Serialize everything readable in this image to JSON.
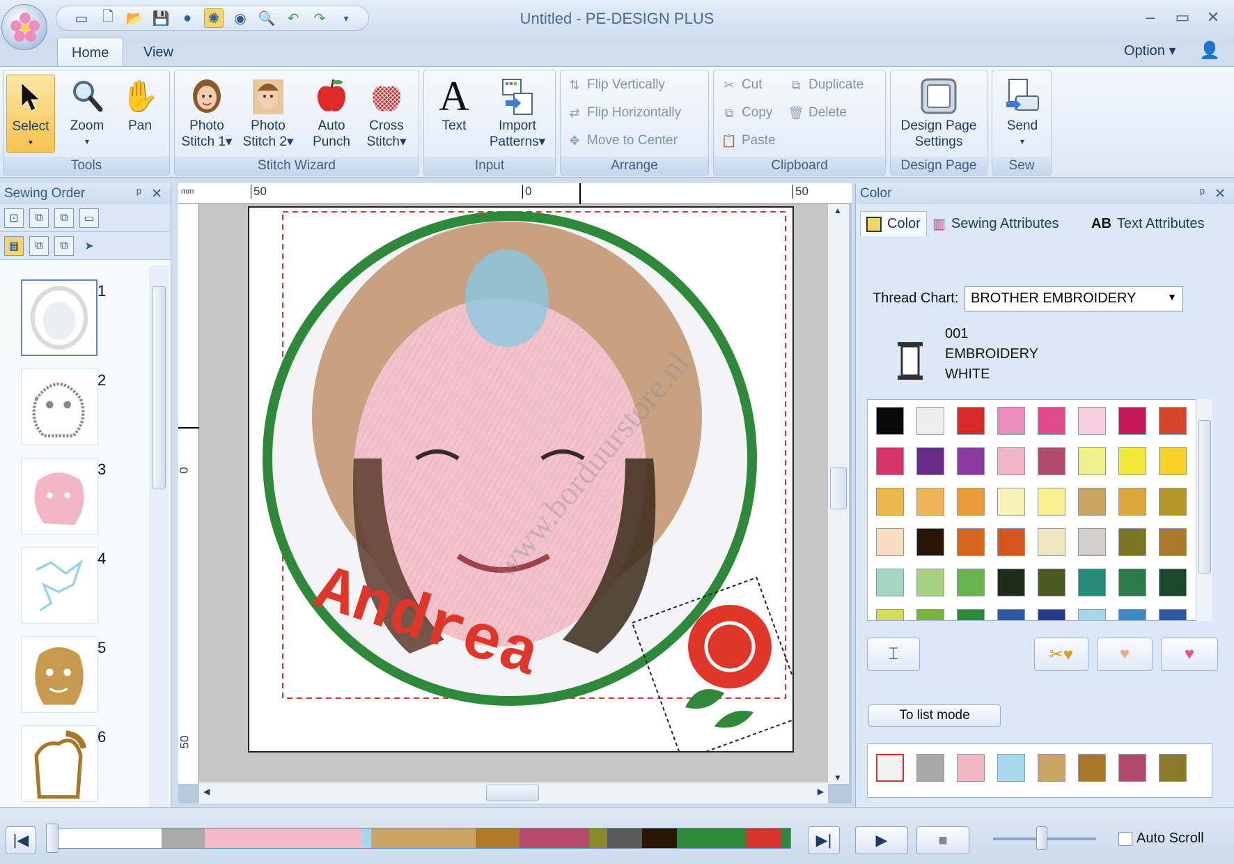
{
  "window": {
    "title": "Untitled - PE-DESIGN PLUS",
    "minimize": "–",
    "maximize": "▭",
    "close": "✕"
  },
  "quick_access": [
    "new-doc",
    "open",
    "save",
    "stop",
    "stitch-sim",
    "circle",
    "zoom",
    "undo",
    "redo",
    "customize"
  ],
  "tabs": [
    {
      "label": "Home",
      "active": true
    },
    {
      "label": "View",
      "active": false
    }
  ],
  "option": {
    "label": "Option"
  },
  "ribbon": {
    "tools": {
      "label": "Tools",
      "select": "Select",
      "zoom": "Zoom",
      "pan": "Pan"
    },
    "stitch_wizard": {
      "label": "Stitch Wizard",
      "photo1_a": "Photo",
      "photo1_b": "Stitch 1",
      "photo2_a": "Photo",
      "photo2_b": "Stitch 2",
      "auto_a": "Auto",
      "auto_b": "Punch",
      "cross_a": "Cross",
      "cross_b": "Stitch"
    },
    "input": {
      "label": "Input",
      "text": "Text",
      "import_a": "Import",
      "import_b": "Patterns"
    },
    "arrange": {
      "label": "Arrange",
      "flip_v": "Flip Vertically",
      "flip_h": "Flip Horizontally",
      "move_center": "Move to Center"
    },
    "clipboard": {
      "label": "Clipboard",
      "cut": "Cut",
      "copy": "Copy",
      "paste": "Paste",
      "duplicate": "Duplicate",
      "delete": "Delete"
    },
    "design_page": {
      "label": "Design Page",
      "settings_a": "Design Page",
      "settings_b": "Settings"
    },
    "sew": {
      "label": "Sew",
      "send": "Send"
    }
  },
  "sewing_order": {
    "title": "Sewing Order",
    "pin": "ᵖ",
    "close": "✕",
    "items": [
      {
        "num": "1",
        "color": "#e9ecef"
      },
      {
        "num": "2",
        "color": "#9a9a9a"
      },
      {
        "num": "3",
        "color": "#f2b6c4"
      },
      {
        "num": "4",
        "color": "#8fd3ee"
      },
      {
        "num": "5",
        "color": "#c89a4d"
      },
      {
        "num": "6",
        "color": "#a8772a"
      }
    ]
  },
  "rulers": {
    "unit": "mm",
    "top_left": "50",
    "top_mid": "0",
    "top_right": "50",
    "left_mid": "0",
    "left_bottom": "50"
  },
  "design": {
    "name_text": "Andrea",
    "watermark": "www.borduurstore.nl"
  },
  "color_panel": {
    "title": "Color",
    "pin": "ᵖ",
    "close": "✕",
    "tabs": [
      {
        "label": "Color",
        "active": true
      },
      {
        "label": "Sewing Attributes",
        "active": false
      },
      {
        "label": "Text Attributes",
        "active": false
      }
    ],
    "text_tab_prefix": "AB",
    "thread_chart_label": "Thread Chart:",
    "thread_chart_value": "BROTHER EMBROIDERY",
    "selected_thread": {
      "code": "001",
      "brand": "EMBROIDERY",
      "name": "WHITE"
    },
    "palette": [
      "#0a0a0a",
      "#eeeeee",
      "#d9282a",
      "#ec8dbd",
      "#e04a8a",
      "#f7cfe0",
      "#c4185a",
      "#d6442b",
      "#d9346a",
      "#6a2a8a",
      "#8a3aa0",
      "#f2b6c8",
      "#b24a6a",
      "#eef08a",
      "#f2e838",
      "#f7d028",
      "#efb84a",
      "#f0b458",
      "#eb9a3c",
      "#f8f2b8",
      "#f7ef90",
      "#cba464",
      "#dca63a",
      "#b8962a",
      "#f7dcc0",
      "#2a1606",
      "#d9641e",
      "#d6561e",
      "#efe6c0",
      "#d6cec8",
      "#7a7622",
      "#aa7a2a",
      "#a6d6c0",
      "#a6d080",
      "#68b44e",
      "#1c2e18",
      "#4a5a22",
      "#2a8a7a",
      "#2a7a4a",
      "#1a4a2a",
      "#d6dc56",
      "#7ab43a",
      "#2e8a3a",
      "#2a5aa8",
      "#2a3a8a",
      "#a6d6ea",
      "#3a8ac8",
      "#2a5aa8"
    ],
    "list_mode": "To list mode",
    "used_colors": [
      "#f2f2f2",
      "#a9a9a9",
      "#f2b6c4",
      "#a8d8ec",
      "#cba464",
      "#a8772a",
      "#b24a6a",
      "#8a7a2a"
    ]
  },
  "bottom": {
    "strip": [
      {
        "color": "#ffffff",
        "flex": 12
      },
      {
        "color": "#aaaaaa",
        "flex": 5
      },
      {
        "color": "#f4b8c6",
        "flex": 18
      },
      {
        "color": "#a6d6ea",
        "flex": 1
      },
      {
        "color": "#cba464",
        "flex": 12
      },
      {
        "color": "#b07a2a",
        "flex": 5
      },
      {
        "color": "#b84a6a",
        "flex": 8
      },
      {
        "color": "#8a8a2a",
        "flex": 2
      },
      {
        "color": "#5a5a5a",
        "flex": 4
      },
      {
        "color": "#2a1606",
        "flex": 4
      },
      {
        "color": "#2e8a3a",
        "flex": 8
      },
      {
        "color": "#d9342a",
        "flex": 4
      },
      {
        "color": "#2e8a3a",
        "flex": 1
      }
    ],
    "auto_scroll": "Auto Scroll",
    "play": "▶",
    "stop": "■",
    "first": "|◀",
    "last": "▶|"
  }
}
